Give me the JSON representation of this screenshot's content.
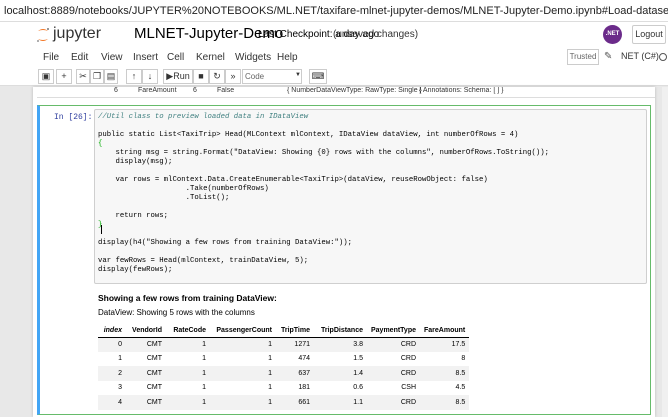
{
  "browser": {
    "url": "localhost:8889/notebooks/JUPYTER%20NOTEBOOKS/ML.NET/taxifare-mlnet-jupyter-demos/MLNET-Jupyter-Demo.ipynb#Load-datasets-into-IData..."
  },
  "header": {
    "brand": "jupyter",
    "notebook_title": "MLNET-Jupyter-Demo",
    "checkpoint": "Last Checkpoint: a day ago",
    "unsaved": "(unsaved changes)",
    "net_badge": ".NET",
    "logout_label": "Logout"
  },
  "menu": {
    "items": [
      "File",
      "Edit",
      "View",
      "Insert",
      "Cell",
      "Kernel",
      "Widgets",
      "Help"
    ],
    "trusted_label": "Trusted",
    "kernel_label": "NET (C#)"
  },
  "toolbar": {
    "save_icon": "save-icon",
    "add_icon": "plus-icon",
    "run_label": "Run",
    "cell_type": "Code"
  },
  "prev_output": {
    "row": [
      "6",
      "FareAmount",
      "6",
      "False",
      "{ NumberDataViewType: RawType: Single }",
      "{ Annotations: Schema: [ ] }"
    ]
  },
  "cell": {
    "prompt": "In [26]:",
    "code_lines": [
      "//Util class to preview loaded data in IDataView",
      "",
      "public static List<TaxiTrip> Head(MLContext mlContext, IDataView dataView, int numberOfRows = 4)",
      "{",
      "    string msg = string.Format(\"DataView: Showing {0} rows with the columns\", numberOfRows.ToString());",
      "    display(msg);",
      "",
      "    var rows = mlContext.Data.CreateEnumerable<TaxiTrip>(dataView, reuseRowObject: false)",
      "                    .Take(numberOfRows)",
      "                    .ToList();",
      "",
      "    return rows;",
      "}",
      "",
      "display(h4(\"Showing a few rows from training DataView:\"));",
      "",
      "var fewRows = Head(mlContext, trainDataView, 5);",
      "display(fewRows);"
    ]
  },
  "output": {
    "heading": "Showing a few rows from training DataView:",
    "message": "DataView: Showing 5 rows with the columns",
    "columns": [
      "index",
      "VendorId",
      "RateCode",
      "PassengerCount",
      "TripTime",
      "TripDistance",
      "PaymentType",
      "FareAmount"
    ],
    "rows": [
      [
        "0",
        "CMT",
        "1",
        "1",
        "1271",
        "3.8",
        "CRD",
        "17.5"
      ],
      [
        "1",
        "CMT",
        "1",
        "1",
        "474",
        "1.5",
        "CRD",
        "8"
      ],
      [
        "2",
        "CMT",
        "1",
        "1",
        "637",
        "1.4",
        "CRD",
        "8.5"
      ],
      [
        "3",
        "CMT",
        "1",
        "1",
        "181",
        "0.6",
        "CSH",
        "4.5"
      ],
      [
        "4",
        "CMT",
        "1",
        "1",
        "661",
        "1.1",
        "CRD",
        "8.5"
      ]
    ]
  },
  "colors": {
    "prompt": "#303f9f",
    "cell_border": "#66bb6a",
    "cell_left": "#42a5f5",
    "jupyter_orange": "#f37726"
  }
}
